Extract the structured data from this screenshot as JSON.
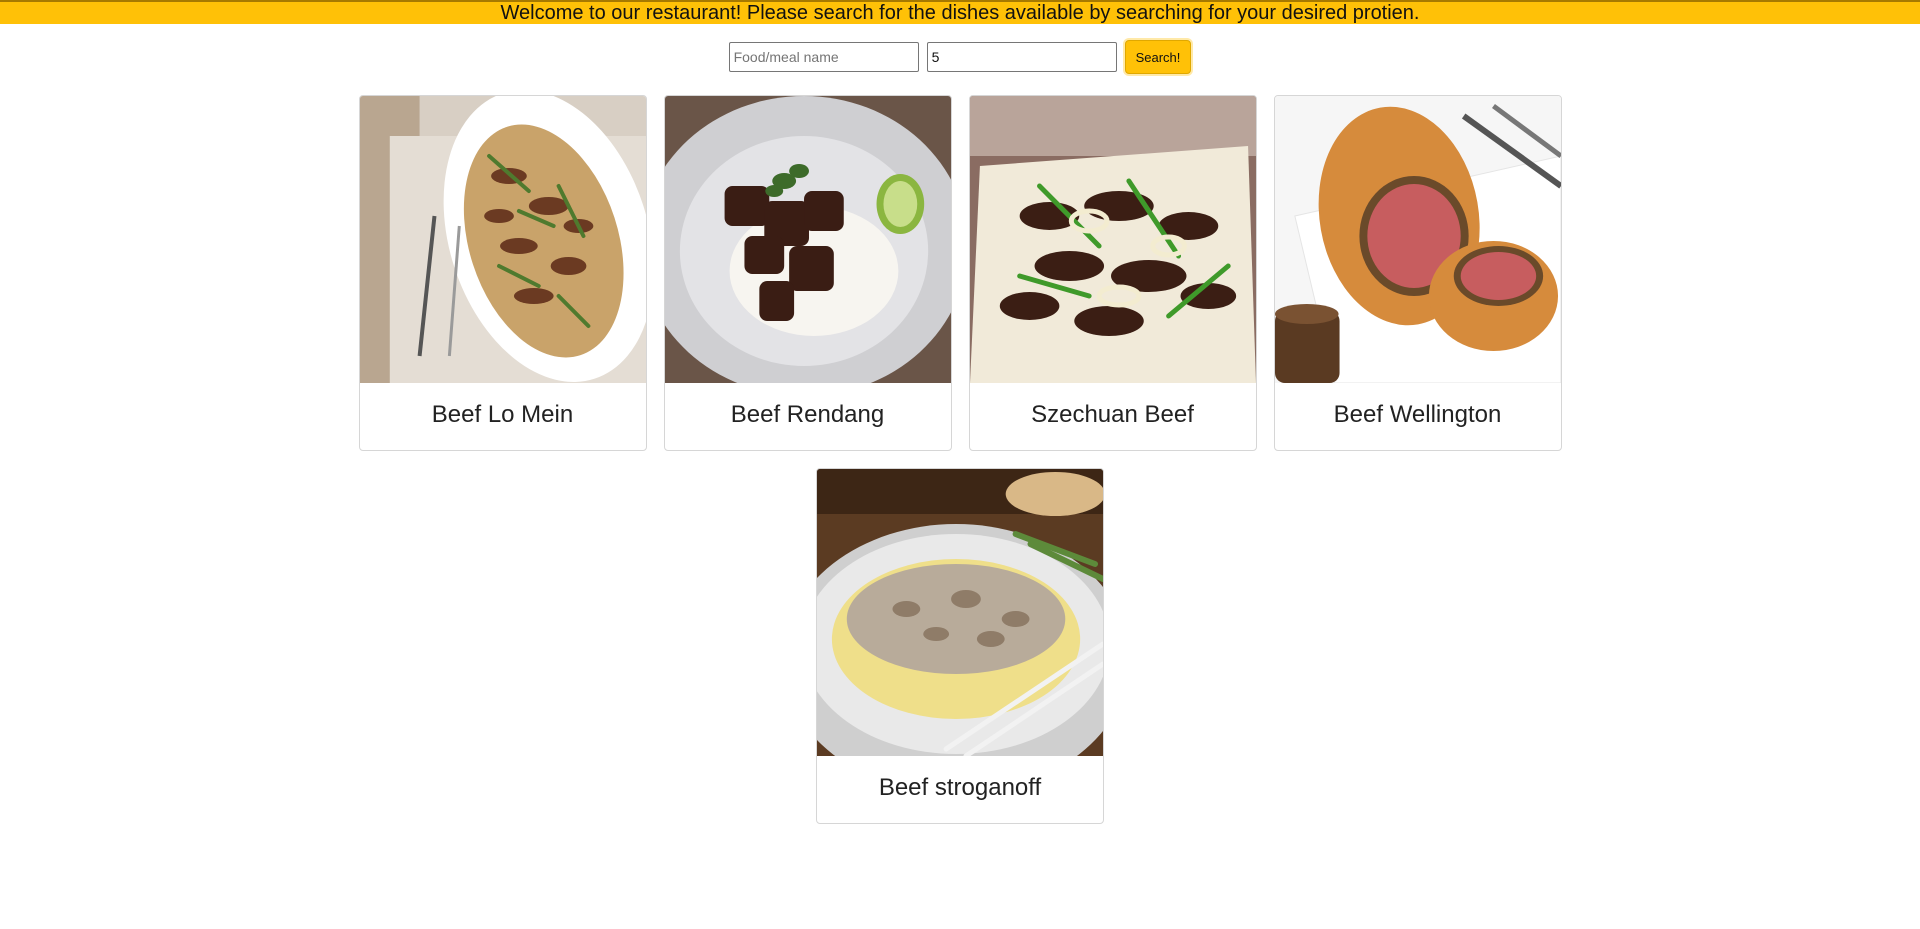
{
  "banner": {
    "text": "Welcome to our restaurant! Please search for the dishes available by searching for your desired protien."
  },
  "search": {
    "name_placeholder": "Food/meal name",
    "name_value": "",
    "count_value": "5",
    "button_label": "Search!"
  },
  "meals": [
    {
      "name": "Beef Lo Mein",
      "image": "beef-lo-mein-photo"
    },
    {
      "name": "Beef Rendang",
      "image": "beef-rendang-photo"
    },
    {
      "name": "Szechuan Beef",
      "image": "szechuan-beef-photo"
    },
    {
      "name": "Beef Wellington",
      "image": "beef-wellington-photo"
    },
    {
      "name": "Beef stroganoff",
      "image": "beef-stroganoff-photo"
    }
  ],
  "colors": {
    "accent": "#ffc107"
  }
}
